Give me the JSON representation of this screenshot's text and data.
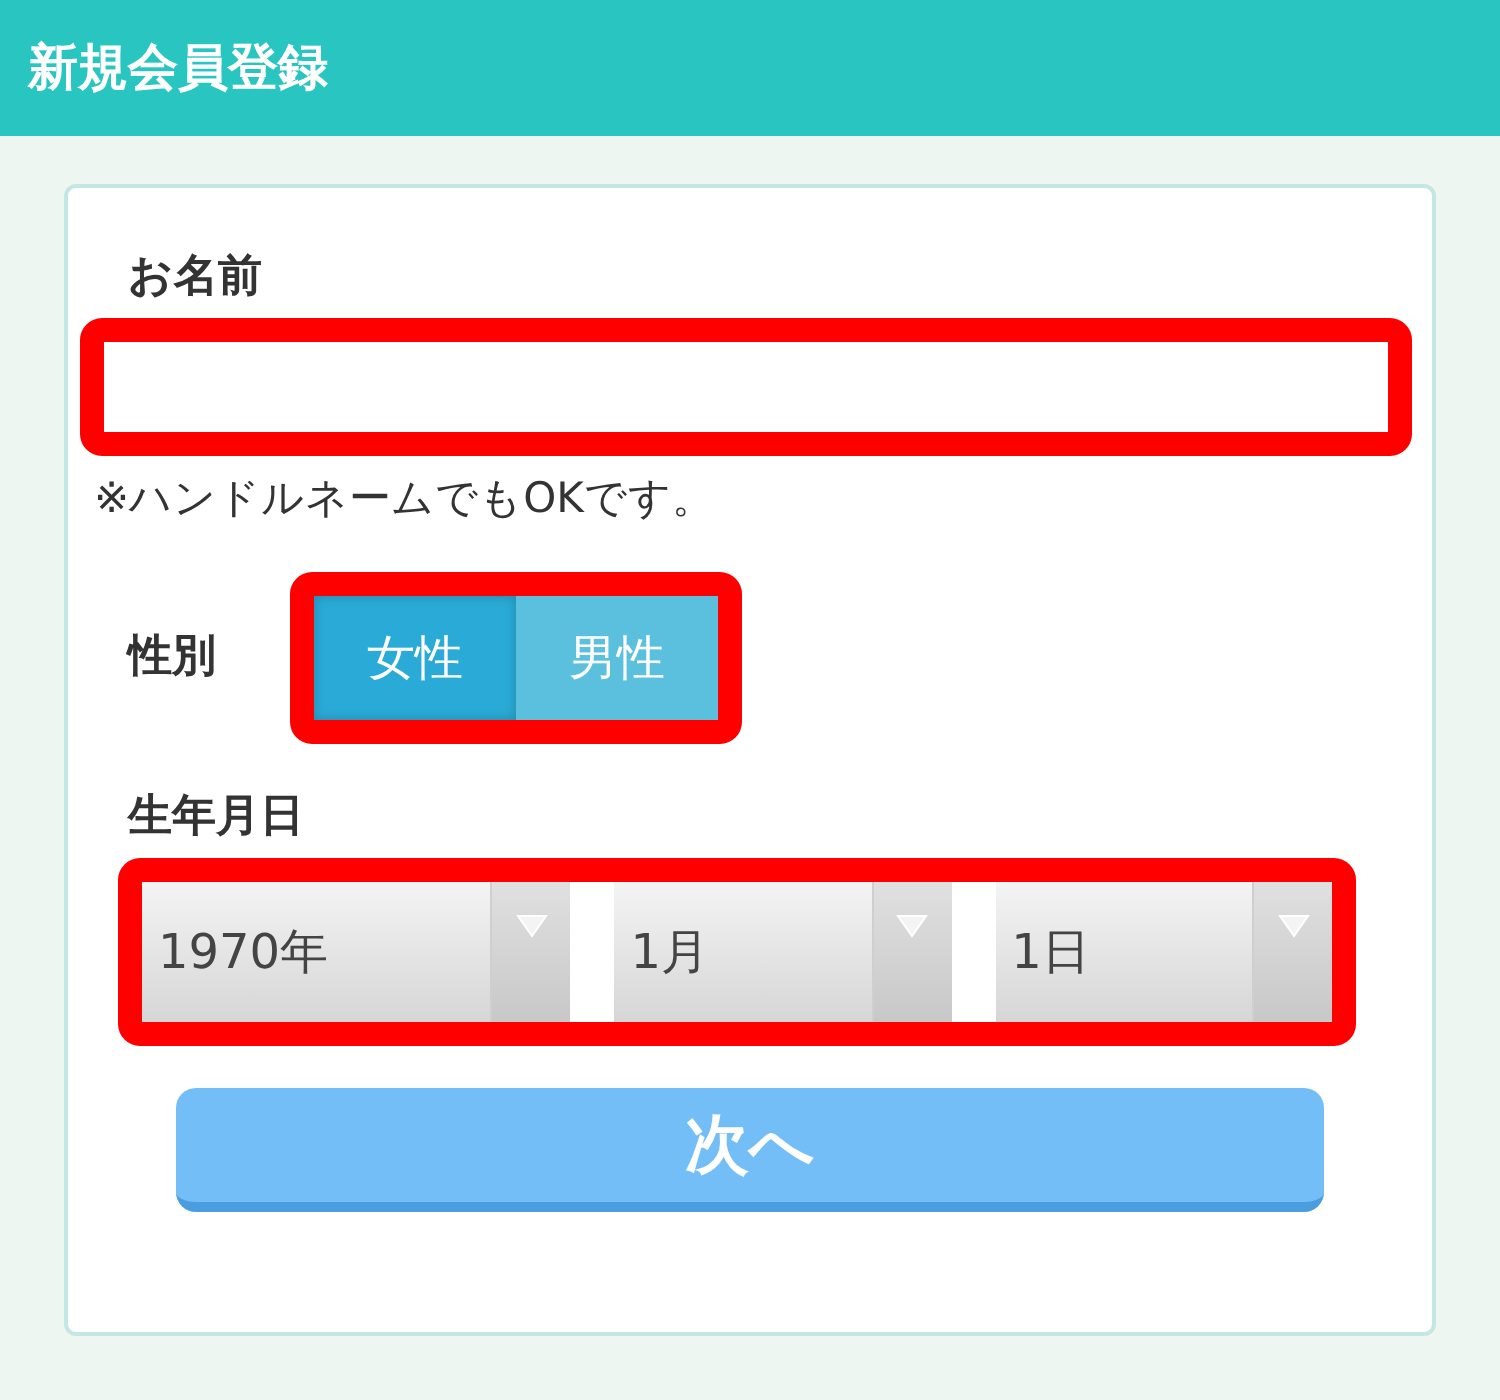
{
  "header": {
    "title": "新規会員登録"
  },
  "name_field": {
    "label": "お名前",
    "highlighted": true,
    "note": "※ハンドルネームでもOKです。"
  },
  "gender": {
    "label": "性別",
    "highlighted": true,
    "options": [
      {
        "label": "女性",
        "selected": true
      },
      {
        "label": "男性",
        "selected": false
      }
    ]
  },
  "birthday": {
    "label": "生年月日",
    "highlighted": true,
    "selects": [
      {
        "value": "1970年"
      },
      {
        "value": "1月"
      },
      {
        "value": "1日"
      }
    ]
  },
  "next_button": {
    "label": "次へ"
  }
}
